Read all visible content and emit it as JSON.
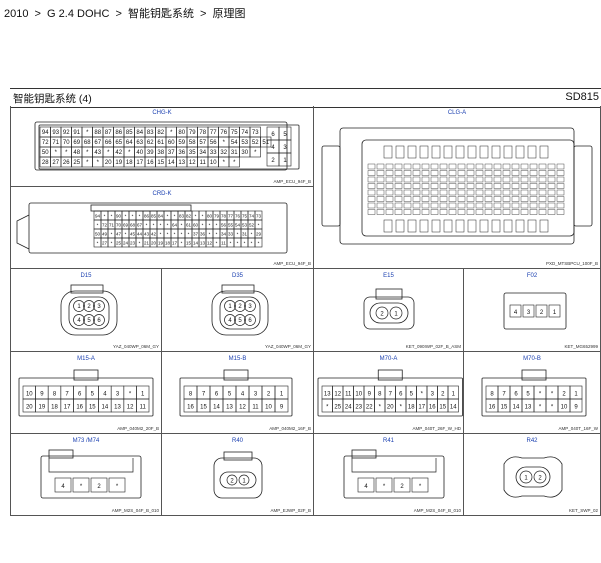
{
  "breadcrumb": {
    "year": "2010",
    "engine": "G 2.4 DOHC",
    "system": "智能钥匙系统",
    "page": "原理图",
    "separator": ">"
  },
  "header": {
    "title": "智能钥匙系统 (4)",
    "code": "SD815"
  },
  "colors": {
    "connector_label": "#1a3fb0",
    "line": "#222222"
  },
  "connectors": {
    "chg_k": {
      "name": "CHG-K",
      "part": "AMP_ECU_94F_B",
      "rows": [
        [
          "94",
          "93",
          "92",
          "91",
          "*",
          "88",
          "87",
          "86",
          "85",
          "84",
          "83",
          "82",
          "*",
          "80",
          "79",
          "78",
          "77",
          "76",
          "75",
          "74",
          "73"
        ],
        [
          "72",
          "71",
          "70",
          "69",
          "68",
          "67",
          "66",
          "65",
          "64",
          "63",
          "62",
          "61",
          "60",
          "59",
          "58",
          "57",
          "56",
          "*",
          "54",
          "53",
          "52",
          "51"
        ],
        [
          "50",
          "*",
          "*",
          "48",
          "*",
          "43",
          "*",
          "42",
          "*",
          "40",
          "39",
          "38",
          "37",
          "36",
          "35",
          "34",
          "33",
          "32",
          "31",
          "30",
          "*"
        ],
        [
          "28",
          "27",
          "26",
          "25",
          "*",
          "*",
          "20",
          "19",
          "18",
          "17",
          "16",
          "15",
          "14",
          "13",
          "12",
          "11",
          "10",
          "*",
          "*"
        ]
      ],
      "side": [
        "6",
        "5",
        "4",
        "3",
        "2",
        "1"
      ]
    },
    "clg_a": {
      "name": "CLG-A",
      "part": "PXD_MTSBPCU_100F_B"
    },
    "crd_k": {
      "name": "CRD-K",
      "part": "AMP_ECU_94F_B",
      "rows": [
        [
          "94",
          "*",
          "*",
          "90",
          "*",
          "*",
          "*",
          "86",
          "85",
          "84",
          "*",
          "*",
          "83",
          "82",
          "*",
          "*",
          "80",
          "79",
          "78",
          "77",
          "76",
          "75",
          "74",
          "73"
        ],
        [
          "*",
          "72",
          "71",
          "70",
          "69",
          "68",
          "67",
          "*",
          "*",
          "*",
          "*",
          "64",
          "*",
          "61",
          "60",
          "*",
          "*",
          "*",
          "56",
          "55",
          "54",
          "53",
          "52",
          "*"
        ],
        [
          "50",
          "49",
          "*",
          "47",
          "*",
          "45",
          "44",
          "43",
          "42",
          "*",
          "*",
          "*",
          "*",
          "*",
          "37",
          "36",
          "*",
          "*",
          "34",
          "33",
          "*",
          "31",
          "*",
          "29"
        ],
        [
          "*",
          "27",
          "*",
          "25",
          "24",
          "23",
          "*",
          "21",
          "20",
          "19",
          "18",
          "17",
          "*",
          "15",
          "14",
          "13",
          "12",
          "*",
          "11",
          "*",
          "*",
          "*",
          "*",
          "*"
        ]
      ]
    },
    "d15": {
      "name": "D15",
      "part": "YAZ_040WP_06M_GY",
      "pins": [
        "1",
        "2",
        "3",
        "4",
        "5",
        "6"
      ]
    },
    "d35": {
      "name": "D35",
      "part": "YAZ_040WP_06M_GY",
      "pins": [
        "1",
        "2",
        "3",
        "4",
        "5",
        "6"
      ]
    },
    "e15": {
      "name": "E15",
      "part": "KET_090IWP_02F_B_ASM",
      "pins": [
        "2",
        "1"
      ]
    },
    "f02": {
      "name": "F02",
      "part": "KET_MG652999",
      "pins": [
        "4",
        "3",
        "2",
        "1"
      ]
    },
    "m15_a": {
      "name": "M15-A",
      "part": "AMP_040M2_20F_B",
      "rows": [
        [
          "10",
          "9",
          "8",
          "7",
          "6",
          "5",
          "4",
          "3",
          "*",
          "1"
        ],
        [
          "20",
          "19",
          "18",
          "17",
          "16",
          "15",
          "14",
          "13",
          "12",
          "11"
        ]
      ]
    },
    "m15_b": {
      "name": "M15-B",
      "part": "AMP_040M2_16F_B",
      "rows": [
        [
          "8",
          "7",
          "6",
          "5",
          "4",
          "3",
          "2",
          "1"
        ],
        [
          "16",
          "15",
          "14",
          "13",
          "12",
          "11",
          "10",
          "9"
        ]
      ]
    },
    "m70_a": {
      "name": "M70-A",
      "part": "AMP_040T_26F_W_HD",
      "rows": [
        [
          "13",
          "12",
          "11",
          "10",
          "9",
          "8",
          "7",
          "6",
          "5",
          "*",
          "3",
          "2",
          "1"
        ],
        [
          "*",
          "25",
          "24",
          "23",
          "22",
          "*",
          "20",
          "*",
          "18",
          "17",
          "16",
          "15",
          "14"
        ]
      ]
    },
    "m70_b": {
      "name": "M70-B",
      "part": "AMP_040T_16F_W",
      "rows": [
        [
          "8",
          "7",
          "6",
          "5",
          "*",
          "*",
          "2",
          "1"
        ],
        [
          "16",
          "15",
          "14",
          "13",
          "*",
          "*",
          "10",
          "9"
        ]
      ]
    },
    "m73_m74": {
      "name": "M73 /M74",
      "part": "AMP_M2S_04F_B_010",
      "pins": [
        "4",
        "*",
        "2",
        "*"
      ]
    },
    "r40": {
      "name": "R40",
      "part": "AMP_EJWP_02F_B",
      "pins": [
        "2",
        "1"
      ]
    },
    "r41": {
      "name": "R41",
      "part": "AMP_M2S_04F_B_010",
      "pins": [
        "4",
        "*",
        "2",
        "*"
      ]
    },
    "r42": {
      "name": "R42",
      "part": "KET_SWP_02",
      "pins": [
        "1",
        "2"
      ]
    }
  }
}
